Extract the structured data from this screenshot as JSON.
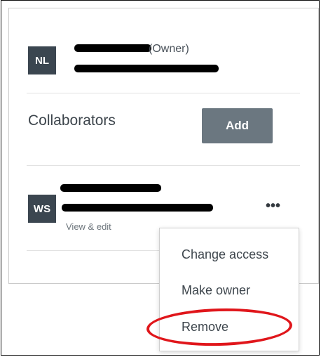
{
  "owner": {
    "initials": "NL",
    "role_label": "(Owner)"
  },
  "collaborators": {
    "title": "Collaborators",
    "add_label": "Add",
    "items": [
      {
        "initials": "WS",
        "permission": "View & edit",
        "more_label": "•••"
      }
    ]
  },
  "context_menu": {
    "items": [
      {
        "label": "Change access"
      },
      {
        "label": "Make owner"
      },
      {
        "label": "Remove"
      }
    ],
    "highlight_color": "#e0161b"
  },
  "colors": {
    "avatar_bg": "#3b4650",
    "button_bg": "#6b7780"
  }
}
